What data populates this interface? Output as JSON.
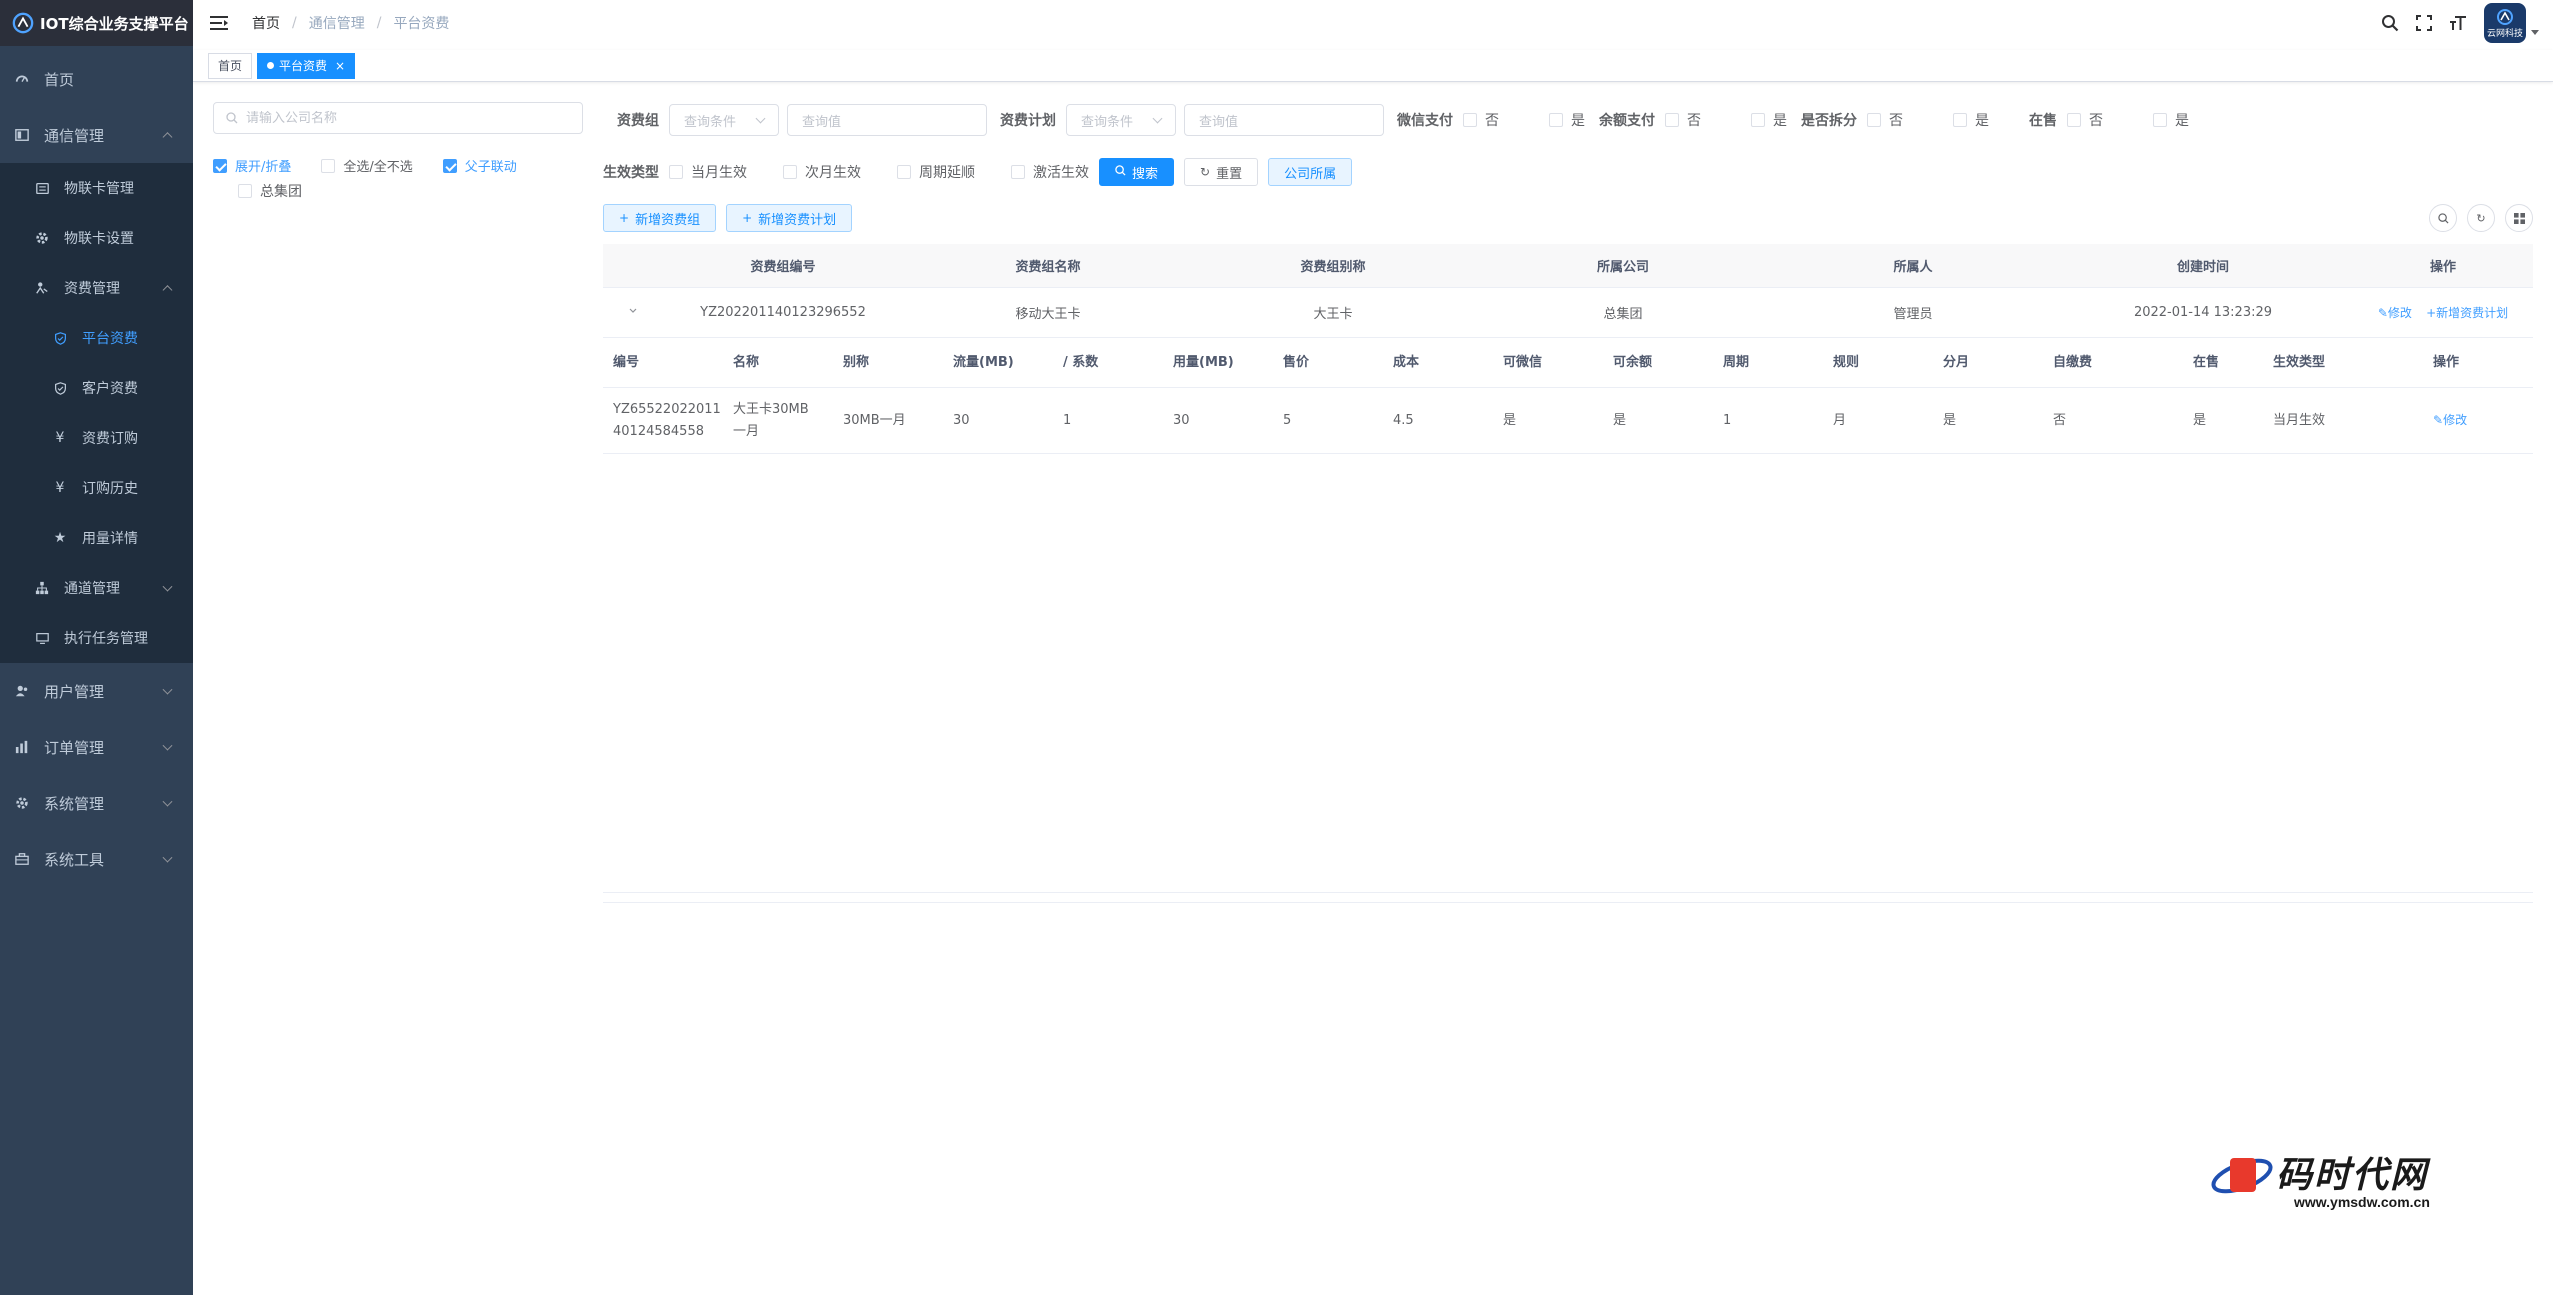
{
  "app": {
    "title": "IOT综合业务支撑平台"
  },
  "sidebar": {
    "items": [
      {
        "label": "首页",
        "icon": "dashboard-icon"
      },
      {
        "label": "通信管理",
        "icon": "communication-icon",
        "expanded": true,
        "children": [
          {
            "label": "物联卡管理",
            "icon": "card-icon"
          },
          {
            "label": "物联卡设置",
            "icon": "gear-icon"
          },
          {
            "label": "资费管理",
            "icon": "fee-icon",
            "expanded": true,
            "children": [
              {
                "label": "平台资费",
                "icon": "shield-icon",
                "active": true
              },
              {
                "label": "客户资费",
                "icon": "shield-icon"
              },
              {
                "label": "资费订购",
                "icon": "yen-icon"
              },
              {
                "label": "订购历史",
                "icon": "yen-icon"
              },
              {
                "label": "用量详情",
                "icon": "star-icon"
              }
            ]
          },
          {
            "label": "通道管理",
            "icon": "tree-icon"
          },
          {
            "label": "执行任务管理",
            "icon": "monitor-icon"
          }
        ]
      },
      {
        "label": "用户管理",
        "icon": "user-icon"
      },
      {
        "label": "订单管理",
        "icon": "chart-icon"
      },
      {
        "label": "系统管理",
        "icon": "gear-icon"
      },
      {
        "label": "系统工具",
        "icon": "tool-icon"
      }
    ]
  },
  "navbar": {
    "breadcrumb": [
      "首页",
      "通信管理",
      "平台资费"
    ],
    "avatar_text": "云网科技"
  },
  "tags": [
    {
      "label": "首页",
      "active": false
    },
    {
      "label": "平台资费",
      "active": true,
      "close": "×"
    }
  ],
  "tree": {
    "search_placeholder": "请输入公司名称",
    "opt_expand": "展开/折叠",
    "opt_select_all": "全选/全不选",
    "opt_linkage": "父子联动",
    "nodes": [
      "总集团"
    ]
  },
  "filters": {
    "group_label": "资费组",
    "plan_label": "资费计划",
    "select_placeholder": "查询条件",
    "input_placeholder": "查询值",
    "wechat_label": "微信支付",
    "balance_label": "余额支付",
    "split_label": "是否拆分",
    "onsale_label": "在售",
    "no": "否",
    "yes": "是",
    "effect_label": "生效类型",
    "effect_options": [
      "当月生效",
      "次月生效",
      "周期延顺",
      "激活生效"
    ],
    "search_btn": "搜索",
    "reset_btn": "重置",
    "company_btn": "公司所属"
  },
  "toolbar": {
    "add_group": "新增资费组",
    "add_plan": "新增资费计划"
  },
  "main_table": {
    "headers": [
      "资费组编号",
      "资费组名称",
      "资费组别称",
      "所属公司",
      "所属人",
      "创建时间",
      "操作"
    ],
    "rows": [
      {
        "id": "YZ202201140123296552",
        "name": "移动大王卡",
        "alias": "大王卡",
        "company": "总集团",
        "owner": "管理员",
        "created": "2022-01-14 13:23:29",
        "edit": "修改",
        "add_plan": "新增资费计划"
      }
    ]
  },
  "sub_table": {
    "headers": [
      "编号",
      "名称",
      "别称",
      "流量(MB)",
      "/ 系数",
      "用量(MB)",
      "售价",
      "成本",
      "可微信",
      "可余额",
      "周期",
      "规则",
      "分月",
      "自缴费",
      "在售",
      "生效类型",
      "操作"
    ],
    "rows": [
      {
        "code": "YZ6552202201140124584558",
        "code_line1": "YZ65522022011",
        "code_line2": "40124584558",
        "name_line1": "大王卡30MB",
        "name_line2": "一月",
        "alias": "30MB一月",
        "flow": "30",
        "factor": "1",
        "usage": "30",
        "price": "5",
        "cost": "4.5",
        "wechat": "是",
        "balance": "是",
        "period": "1",
        "rule": "月",
        "split": "是",
        "selfpay": "否",
        "onsale": "是",
        "effect": "当月生效",
        "edit": "修改"
      }
    ]
  },
  "watermark": {
    "text": "码时代网",
    "url": "www.ymsdw.com.cn"
  },
  "colors": {
    "sidebar_bg": "#304156",
    "submenu_bg": "#1f2d3d",
    "accent": "#1890ff",
    "menu_text": "#bfcbd9"
  }
}
